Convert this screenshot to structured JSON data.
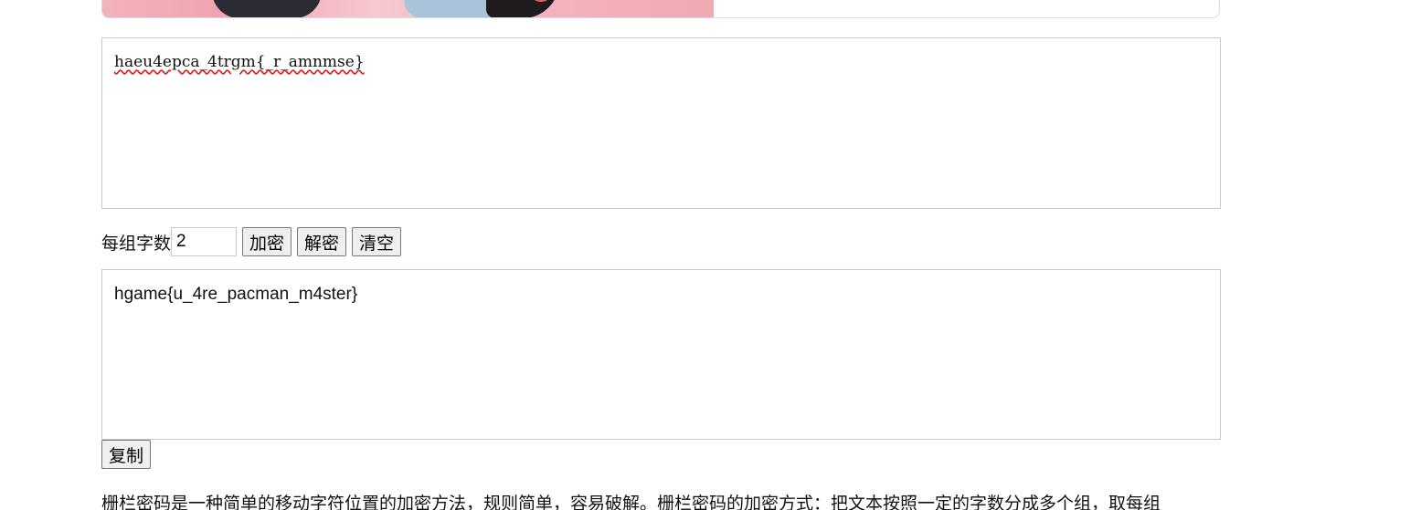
{
  "cipher_text": "haeu4epca_4trgm{_r_amnmse}",
  "controls": {
    "group_label": "每组字数",
    "group_size": "2",
    "encrypt_label": "加密",
    "decrypt_label": "解密",
    "clear_label": "清空"
  },
  "plain_text": "hgame{u_4re_pacman_m4ster}",
  "copy_label": "复制",
  "description": "栅栏密码是一种简单的移动字符位置的加密方法，规则简单，容易破解。栅栏密码的加密方式：把文本按照一定的字数分成多个组，取每组"
}
